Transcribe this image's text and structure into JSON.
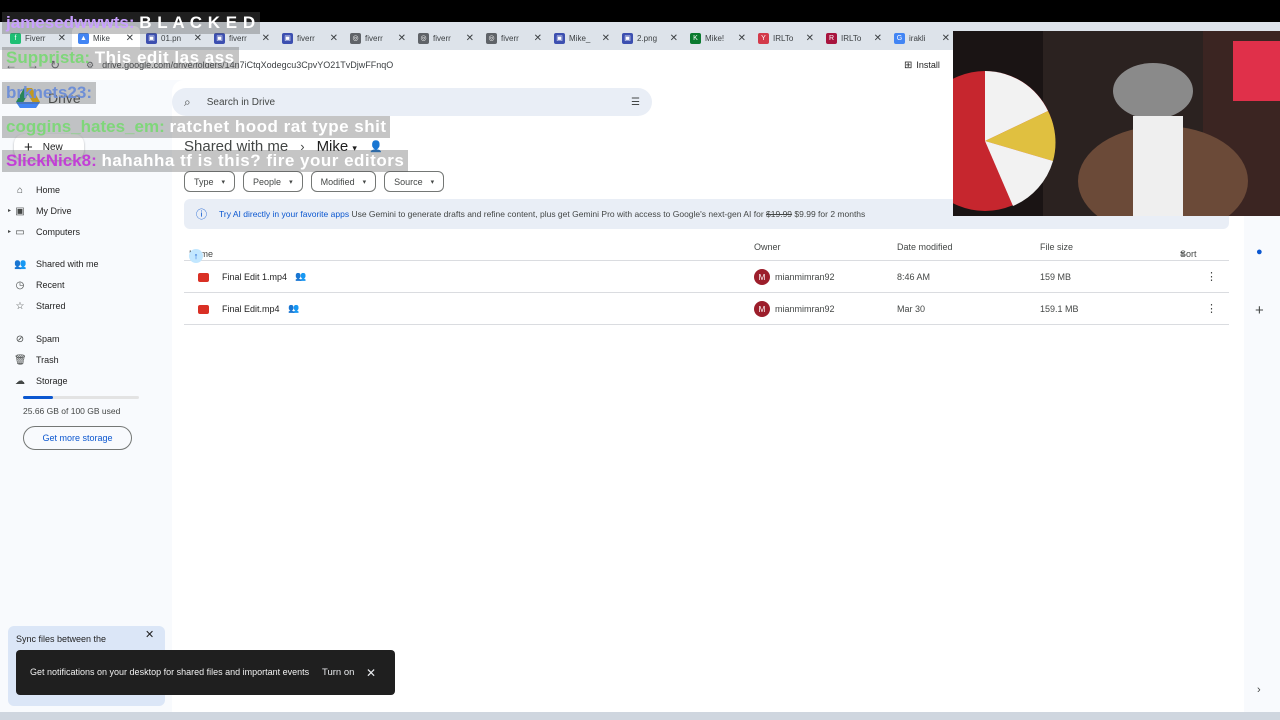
{
  "tabs": [
    {
      "label": "Fiverr",
      "color": "#1dbf73",
      "glyph": "f"
    },
    {
      "label": "Mike",
      "color": "#4285f4",
      "glyph": "▲",
      "active": true
    },
    {
      "label": "01.pn",
      "color": "#3c4fb0",
      "glyph": "▣"
    },
    {
      "label": "fiverr",
      "color": "#3c4fb0",
      "glyph": "▣"
    },
    {
      "label": "fiverr",
      "color": "#3c4fb0",
      "glyph": "▣"
    },
    {
      "label": "fiverr",
      "color": "#5f6368",
      "glyph": "◎"
    },
    {
      "label": "fiverr",
      "color": "#5f6368",
      "glyph": "◎"
    },
    {
      "label": "fiverr",
      "color": "#5f6368",
      "glyph": "◎"
    },
    {
      "label": "Mike_",
      "color": "#3c4fb0",
      "glyph": "▣"
    },
    {
      "label": "2.png",
      "color": "#3c4fb0",
      "glyph": "▣"
    },
    {
      "label": "Mike!",
      "color": "#0a7a2f",
      "glyph": "K"
    },
    {
      "label": "IRLTo",
      "color": "#d33a4a",
      "glyph": "Y"
    },
    {
      "label": "IRLTo",
      "color": "#a8143e",
      "glyph": "R"
    },
    {
      "label": "irakli",
      "color": "#4285f4",
      "glyph": "G"
    }
  ],
  "browser": {
    "url": "drive.google.com/drive/folders/14n7iCtqXodegcu3CpvYO21TvDjwFFnqO",
    "install_label": "Install"
  },
  "drive": {
    "brand": "Drive",
    "new_label": "New",
    "search_placeholder": "Search in Drive",
    "nav": [
      {
        "label": "Home",
        "icon": "home-icon",
        "glyph": "⌂"
      },
      {
        "label": "My Drive",
        "icon": "drive-icon",
        "glyph": "▣"
      },
      {
        "label": "Computers",
        "icon": "computer-icon",
        "glyph": "▭"
      },
      {
        "label": "Shared with me",
        "icon": "people-icon",
        "glyph": "👥"
      },
      {
        "label": "Recent",
        "icon": "clock-icon",
        "glyph": "◷"
      },
      {
        "label": "Starred",
        "icon": "star-icon",
        "glyph": "☆"
      },
      {
        "label": "Spam",
        "icon": "spam-icon",
        "glyph": "⊘"
      },
      {
        "label": "Trash",
        "icon": "trash-icon",
        "glyph": "🗑"
      },
      {
        "label": "Storage",
        "icon": "cloud-icon",
        "glyph": "☁"
      }
    ],
    "storage_used_fraction": 0.2566,
    "storage_text": "25.66 GB of 100 GB used",
    "get_storage_label": "Get more storage",
    "breadcrumb": {
      "root": "Shared with me",
      "current": "Mike"
    },
    "filters": [
      "Type",
      "People",
      "Modified",
      "Source"
    ],
    "banner": {
      "title": "Try AI directly in your favorite apps",
      "text": "Use Gemini to generate drafts and refine content, plus get Gemini Pro with access to Google's next-gen AI for",
      "old_price": "$19.99",
      "new_price": "$9.99 for 2 months"
    },
    "columns": {
      "name": "Name",
      "owner": "Owner",
      "modified": "Date modified",
      "size": "File size",
      "sort": "Sort"
    },
    "files": [
      {
        "name": "Final Edit 1.mp4",
        "owner": "mianmimran92",
        "owner_initial": "M",
        "modified": "8:46 AM",
        "size": "159 MB"
      },
      {
        "name": "Final Edit.mp4",
        "owner": "mianmimran92",
        "owner_initial": "M",
        "modified": "Mar 30",
        "size": "159.1 MB"
      }
    ]
  },
  "chat": [
    {
      "user": "jamesedwwwts",
      "msg": "B L A C K E D"
    },
    {
      "user": "Supprista",
      "msg": "This edit las ass"
    },
    {
      "user": "brknets23",
      "msg": ""
    },
    {
      "user": "coggins_hates_em",
      "msg": "ratchet hood rat type shit"
    },
    {
      "user": "SlickNick8",
      "msg": "hahahha tf is this? fire your editors"
    }
  ],
  "toasts": {
    "sync": "Sync files between the",
    "notification": "Get notifications on your desktop for shared files and important events",
    "turn_on": "Turn on"
  }
}
